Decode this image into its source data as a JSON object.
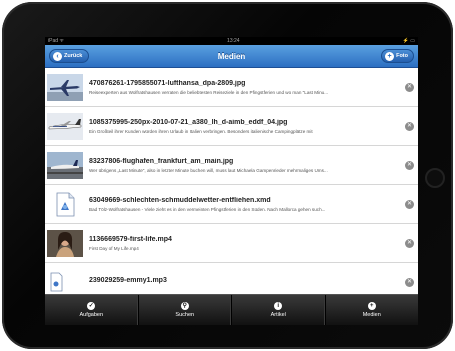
{
  "status": {
    "left": "iPad ᯤ",
    "time": "13:24",
    "right": "⚡ ▭"
  },
  "navbar": {
    "back_label": "Zurück",
    "title": "Medien",
    "add_label": "Foto"
  },
  "items": [
    {
      "title": "470876261-1795855071-lufthansa_dpa-2809.jpg",
      "subtitle": "Reiseexperten aus Wolfratshausen verraten die beliebtesten Reiseziele in den Pfingstferien und wo man \"Last Minu...",
      "thumb": "plane-photo"
    },
    {
      "title": "1085375995-250px-2010-07-21_a380_lh_d-aimb_eddf_04.jpg",
      "subtitle": "Ein Großteil ihrer Kunden würden ihren Urlaub in Italien verbringen. Besonders italienische Campingplätze mit",
      "thumb": "a380-photo"
    },
    {
      "title": "83237806-flughafen_frankfurt_am_main.jpg",
      "subtitle": "Wer übrigens „Last Minute\", also in letzter Minute buchen will, muss laut Michaela Gampenrieder mehrmaliges Ums...",
      "thumb": "airport-photo"
    },
    {
      "title": "63049669-schlechten-schmuddelwetter-entfliehen.xmd",
      "subtitle": "Bad Tölz-Wolfratshausen - Viele zieht es in den vermeinten Pfingstferien in den Süden. Nach Mallorca gehen such...",
      "thumb": "xmd-document-icon"
    },
    {
      "title": "1136669579-first-life.mp4",
      "subtitle": "First Day of My Life.mp4",
      "thumb": "video-woman-photo"
    },
    {
      "title": "239029259-emmy1.mp3",
      "subtitle": "",
      "thumb": "audio-file-icon"
    }
  ],
  "tabs": [
    {
      "label": "Aufgaben",
      "icon": "check-icon"
    },
    {
      "label": "Suchen",
      "icon": "search-icon"
    },
    {
      "label": "Artikel",
      "icon": "info-icon"
    },
    {
      "label": "Medien",
      "icon": "plus-icon"
    }
  ],
  "colors": {
    "nav_top": "#5aa0e0",
    "nav_bottom": "#2c6fc2",
    "tabbar": "#1a1a1a"
  }
}
